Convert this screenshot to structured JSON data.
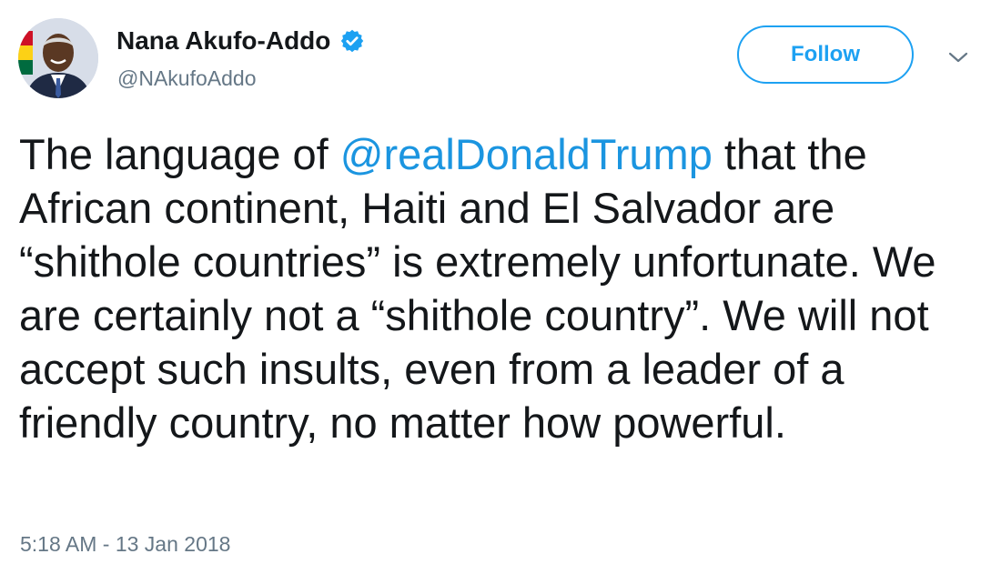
{
  "user": {
    "display_name": "Nana Akufo-Addo",
    "handle": "@NAkufoAddo",
    "verified": true
  },
  "follow_button": {
    "label": "Follow"
  },
  "tweet": {
    "text_before_mention": "The language of ",
    "mention": "@realDonaldTrump",
    "text_after_mention": " that the African continent, Haiti and El Salvador are “shithole countries” is extremely unfortunate. We are certainly not a “shithole country”. We will not accept such insults, even from a leader of a friendly country, no matter how powerful.",
    "timestamp": "5:18 AM - 13 Jan 2018"
  },
  "colors": {
    "link": "#1b95e0",
    "follow_accent": "#1da1f2",
    "secondary_text": "#657786",
    "verified_badge": "#1da1f2"
  },
  "icons": {
    "verified": "verified-badge-icon",
    "caret": "chevron-down-icon"
  }
}
